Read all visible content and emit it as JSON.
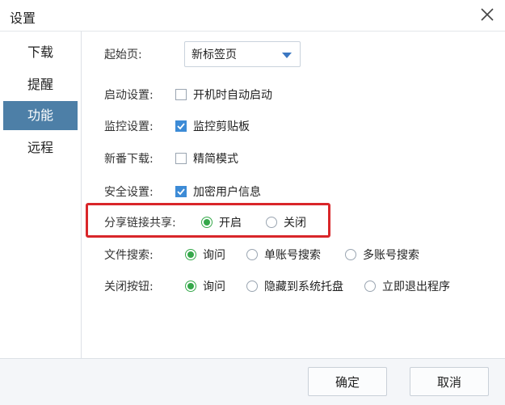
{
  "window": {
    "title": "设置"
  },
  "sidebar": {
    "items": [
      {
        "label": "下载"
      },
      {
        "label": "提醒"
      },
      {
        "label": "功能",
        "active": true
      },
      {
        "label": "远程"
      }
    ]
  },
  "settings": {
    "start_page": {
      "label": "起始页:",
      "value": "新标签页"
    },
    "startup": {
      "label": "启动设置:",
      "option": "开机时自动启动",
      "checked": false
    },
    "monitor": {
      "label": "监控设置:",
      "option": "监控剪贴板",
      "checked": true
    },
    "new_download": {
      "label": "新番下载:",
      "option": "精简模式",
      "checked": false
    },
    "security": {
      "label": "安全设置:",
      "option": "加密用户信息",
      "checked": true
    },
    "share_link": {
      "label": "分享链接共享:",
      "options": [
        "开启",
        "关闭"
      ],
      "selected": 0
    },
    "file_search": {
      "label": "文件搜索:",
      "options": [
        "询问",
        "单账号搜索",
        "多账号搜索"
      ],
      "selected": 0
    },
    "close_button": {
      "label": "关闭按钮:",
      "options": [
        "询问",
        "隐藏到系统托盘",
        "立即退出程序"
      ],
      "selected": 0
    }
  },
  "footer": {
    "ok_label": "确定",
    "cancel_label": "取消"
  },
  "colors": {
    "sidebar_active": "#4d7fa7",
    "checkbox": "#3d8bd6",
    "radio": "#35a84a",
    "highlight": "#d9262a"
  }
}
